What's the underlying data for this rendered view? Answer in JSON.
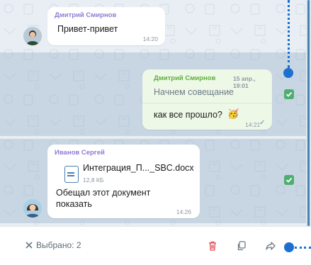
{
  "messages": [
    {
      "sender": "Дмитрий Смирнов",
      "text": "Привет-привет",
      "time": "14:20"
    },
    {
      "quote": {
        "sender": "Дмитрий Смирнов",
        "date": "15 апр., 19:01",
        "text": "Начнем совещание"
      },
      "text": "как все прошло?",
      "emoji": "🥳",
      "time": "14:21",
      "read_mark": "✓",
      "selected": true
    },
    {
      "sender": "Иванов Сергей",
      "file": {
        "name": "Интеграция_П..._SBC.docx",
        "size": "12,8 КБ"
      },
      "text_line1": "Обещал этот документ",
      "text_line2": "показать",
      "time": "14:26",
      "selected": true
    }
  ],
  "bottom_bar": {
    "selected_label": "Выбрано: 2"
  },
  "colors": {
    "accent": "#1d6fd0",
    "check": "#4eae70",
    "sender_purple": "#8e7bd4",
    "sender_green": "#5fae3f",
    "delete_red": "#e5484d"
  },
  "icons": [
    "close-icon",
    "trash-icon",
    "copy-icon",
    "share-icon",
    "file-icon",
    "checkmark-icon"
  ]
}
